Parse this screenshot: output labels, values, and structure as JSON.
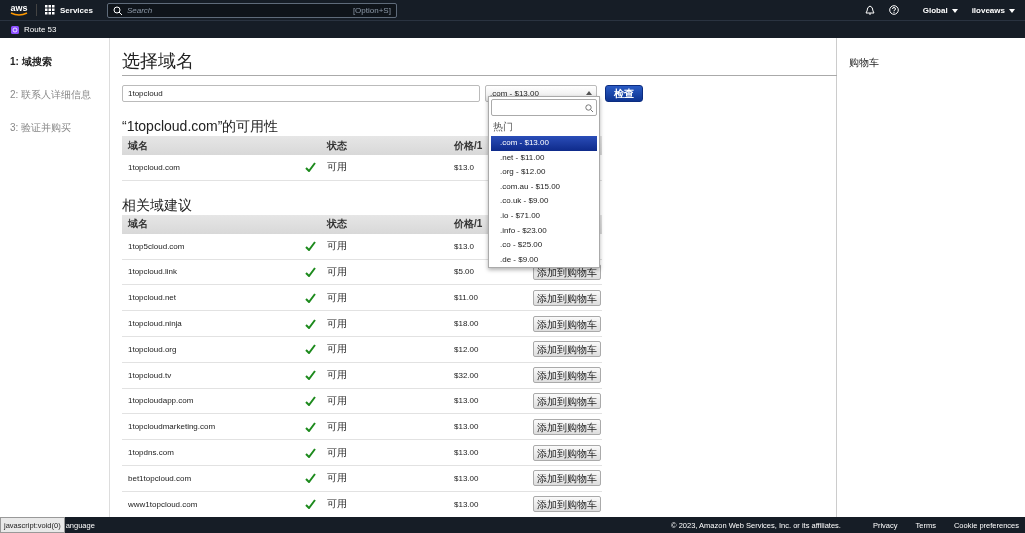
{
  "top_nav": {
    "logo": "aws",
    "services": "Services",
    "search_placeholder": "Search",
    "search_shortcut": "[Option+S]",
    "region": "Global",
    "account": "iloveaws"
  },
  "service_bar": {
    "service": "Route 53"
  },
  "steps": [
    {
      "label": "1: 域搜索",
      "selected": true
    },
    {
      "label": "2: 联系人详细信息",
      "selected": false
    },
    {
      "label": "3: 验证并购买",
      "selected": false
    }
  ],
  "page_title": "选择域名",
  "search": {
    "value": "1topcloud",
    "tld": ".com - $13.00",
    "check_button": "检查"
  },
  "dropdown": {
    "group": "热门",
    "options": [
      {
        "label": ".com - $13.00",
        "selected": true
      },
      {
        "label": ".net - $11.00",
        "selected": false
      },
      {
        "label": ".org - $12.00",
        "selected": false
      },
      {
        "label": ".com.au - $15.00",
        "selected": false
      },
      {
        "label": ".co.uk - $9.00",
        "selected": false
      },
      {
        "label": ".io - $71.00",
        "selected": false
      },
      {
        "label": ".info - $23.00",
        "selected": false
      },
      {
        "label": ".co - $25.00",
        "selected": false
      },
      {
        "label": ".de - $9.00",
        "selected": false
      }
    ]
  },
  "availability": {
    "title": "“1topcloud.com”的可用性",
    "columns": [
      "域名",
      "状态",
      "价格/1"
    ],
    "rows": [
      {
        "domain": "1topcloud.com",
        "status": "可用",
        "price": "$13.0"
      }
    ]
  },
  "suggestions": {
    "title": "相关域建议",
    "columns": [
      "域名",
      "状态",
      "价格/1"
    ],
    "rows": [
      {
        "domain": "1top5cloud.com",
        "status": "可用",
        "price": "$13.0"
      },
      {
        "domain": "1topcloud.link",
        "status": "可用",
        "price": "$5.00",
        "action": "添加到购物车"
      },
      {
        "domain": "1topcloud.net",
        "status": "可用",
        "price": "$11.00",
        "action": "添加到购物车"
      },
      {
        "domain": "1topcloud.ninja",
        "status": "可用",
        "price": "$18.00",
        "action": "添加到购物车"
      },
      {
        "domain": "1topcloud.org",
        "status": "可用",
        "price": "$12.00",
        "action": "添加到购物车"
      },
      {
        "domain": "1topcloud.tv",
        "status": "可用",
        "price": "$32.00",
        "action": "添加到购物车"
      },
      {
        "domain": "1topcloudapp.com",
        "status": "可用",
        "price": "$13.00",
        "action": "添加到购物车"
      },
      {
        "domain": "1topcloudmarketing.com",
        "status": "可用",
        "price": "$13.00",
        "action": "添加到购物车"
      },
      {
        "domain": "1topdns.com",
        "status": "可用",
        "price": "$13.00",
        "action": "添加到购物车"
      },
      {
        "domain": "bet1topcloud.com",
        "status": "可用",
        "price": "$13.00",
        "action": "添加到购物车"
      },
      {
        "domain": "www1topcloud.com",
        "status": "可用",
        "price": "$13.00",
        "action": "添加到购物车"
      }
    ]
  },
  "cart": {
    "title": "购物车"
  },
  "footer": {
    "status_url": "javascript:void(0)",
    "language": "anguage",
    "copyright": "© 2023, Amazon Web Services, Inc. or its affiliates.",
    "links": [
      "Privacy",
      "Terms",
      "Cookie preferences"
    ]
  }
}
